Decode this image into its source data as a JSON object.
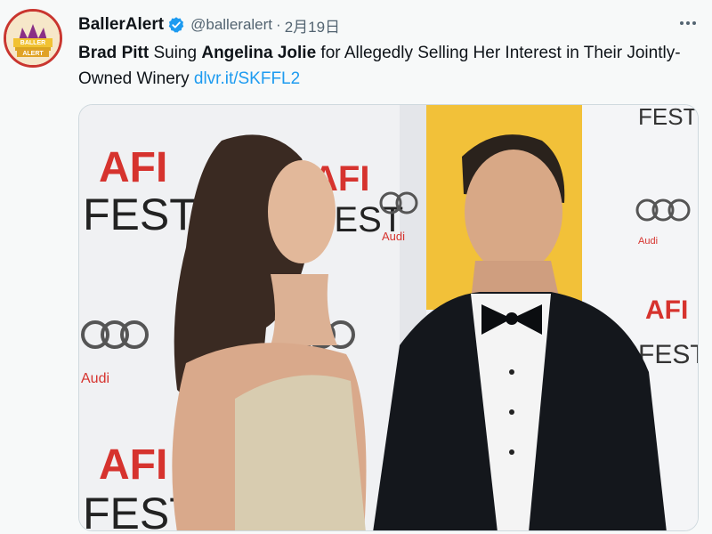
{
  "tweet": {
    "author_name": "BallerAlert",
    "handle": "@balleralert",
    "separator": "·",
    "date": "2月19日",
    "text_parts": {
      "name1": "Brad Pitt",
      "t1": " Suing ",
      "name2": "Angelina Jolie",
      "t2": " for Allegedly Selling Her Interest in Their Jointly-Owned Winery ",
      "link": "dlvr.it/SKFFL2"
    }
  },
  "avatar": {
    "logo_text": "BALLER ALERT"
  },
  "photo": {
    "backdrop_text": {
      "afi": "AFI",
      "fest": "FEST",
      "audi": "Audi"
    }
  },
  "icons": {
    "verified": "verified-badge-icon",
    "more": "more-options-icon"
  },
  "colors": {
    "link": "#1d9bf0",
    "verified": "#1d9bf0",
    "text": "#0f1419",
    "secondary": "#536471",
    "afi_red": "#d6332e",
    "yellow_panel": "#f2c139"
  }
}
